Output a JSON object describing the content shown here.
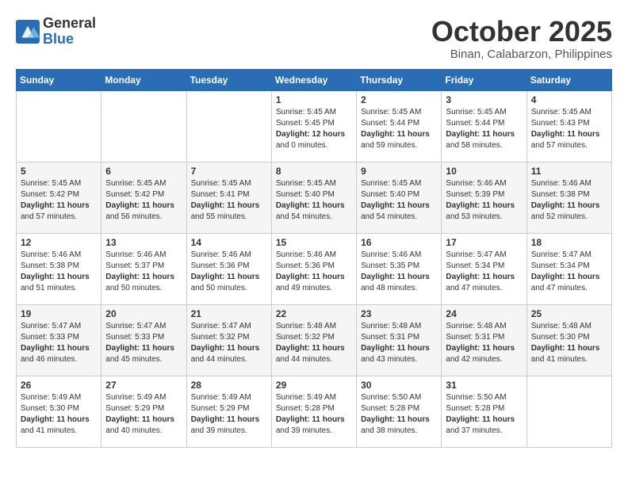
{
  "header": {
    "logo_general": "General",
    "logo_blue": "Blue",
    "month_title": "October 2025",
    "location": "Binan, Calabarzon, Philippines"
  },
  "days_of_week": [
    "Sunday",
    "Monday",
    "Tuesday",
    "Wednesday",
    "Thursday",
    "Friday",
    "Saturday"
  ],
  "weeks": [
    [
      {
        "day": "",
        "content": ""
      },
      {
        "day": "",
        "content": ""
      },
      {
        "day": "",
        "content": ""
      },
      {
        "day": "1",
        "content": "Sunrise: 5:45 AM\nSunset: 5:45 PM\nDaylight: 12 hours\nand 0 minutes."
      },
      {
        "day": "2",
        "content": "Sunrise: 5:45 AM\nSunset: 5:44 PM\nDaylight: 11 hours\nand 59 minutes."
      },
      {
        "day": "3",
        "content": "Sunrise: 5:45 AM\nSunset: 5:44 PM\nDaylight: 11 hours\nand 58 minutes."
      },
      {
        "day": "4",
        "content": "Sunrise: 5:45 AM\nSunset: 5:43 PM\nDaylight: 11 hours\nand 57 minutes."
      }
    ],
    [
      {
        "day": "5",
        "content": "Sunrise: 5:45 AM\nSunset: 5:42 PM\nDaylight: 11 hours\nand 57 minutes."
      },
      {
        "day": "6",
        "content": "Sunrise: 5:45 AM\nSunset: 5:42 PM\nDaylight: 11 hours\nand 56 minutes."
      },
      {
        "day": "7",
        "content": "Sunrise: 5:45 AM\nSunset: 5:41 PM\nDaylight: 11 hours\nand 55 minutes."
      },
      {
        "day": "8",
        "content": "Sunrise: 5:45 AM\nSunset: 5:40 PM\nDaylight: 11 hours\nand 54 minutes."
      },
      {
        "day": "9",
        "content": "Sunrise: 5:45 AM\nSunset: 5:40 PM\nDaylight: 11 hours\nand 54 minutes."
      },
      {
        "day": "10",
        "content": "Sunrise: 5:46 AM\nSunset: 5:39 PM\nDaylight: 11 hours\nand 53 minutes."
      },
      {
        "day": "11",
        "content": "Sunrise: 5:46 AM\nSunset: 5:38 PM\nDaylight: 11 hours\nand 52 minutes."
      }
    ],
    [
      {
        "day": "12",
        "content": "Sunrise: 5:46 AM\nSunset: 5:38 PM\nDaylight: 11 hours\nand 51 minutes."
      },
      {
        "day": "13",
        "content": "Sunrise: 5:46 AM\nSunset: 5:37 PM\nDaylight: 11 hours\nand 50 minutes."
      },
      {
        "day": "14",
        "content": "Sunrise: 5:46 AM\nSunset: 5:36 PM\nDaylight: 11 hours\nand 50 minutes."
      },
      {
        "day": "15",
        "content": "Sunrise: 5:46 AM\nSunset: 5:36 PM\nDaylight: 11 hours\nand 49 minutes."
      },
      {
        "day": "16",
        "content": "Sunrise: 5:46 AM\nSunset: 5:35 PM\nDaylight: 11 hours\nand 48 minutes."
      },
      {
        "day": "17",
        "content": "Sunrise: 5:47 AM\nSunset: 5:34 PM\nDaylight: 11 hours\nand 47 minutes."
      },
      {
        "day": "18",
        "content": "Sunrise: 5:47 AM\nSunset: 5:34 PM\nDaylight: 11 hours\nand 47 minutes."
      }
    ],
    [
      {
        "day": "19",
        "content": "Sunrise: 5:47 AM\nSunset: 5:33 PM\nDaylight: 11 hours\nand 46 minutes."
      },
      {
        "day": "20",
        "content": "Sunrise: 5:47 AM\nSunset: 5:33 PM\nDaylight: 11 hours\nand 45 minutes."
      },
      {
        "day": "21",
        "content": "Sunrise: 5:47 AM\nSunset: 5:32 PM\nDaylight: 11 hours\nand 44 minutes."
      },
      {
        "day": "22",
        "content": "Sunrise: 5:48 AM\nSunset: 5:32 PM\nDaylight: 11 hours\nand 44 minutes."
      },
      {
        "day": "23",
        "content": "Sunrise: 5:48 AM\nSunset: 5:31 PM\nDaylight: 11 hours\nand 43 minutes."
      },
      {
        "day": "24",
        "content": "Sunrise: 5:48 AM\nSunset: 5:31 PM\nDaylight: 11 hours\nand 42 minutes."
      },
      {
        "day": "25",
        "content": "Sunrise: 5:48 AM\nSunset: 5:30 PM\nDaylight: 11 hours\nand 41 minutes."
      }
    ],
    [
      {
        "day": "26",
        "content": "Sunrise: 5:49 AM\nSunset: 5:30 PM\nDaylight: 11 hours\nand 41 minutes."
      },
      {
        "day": "27",
        "content": "Sunrise: 5:49 AM\nSunset: 5:29 PM\nDaylight: 11 hours\nand 40 minutes."
      },
      {
        "day": "28",
        "content": "Sunrise: 5:49 AM\nSunset: 5:29 PM\nDaylight: 11 hours\nand 39 minutes."
      },
      {
        "day": "29",
        "content": "Sunrise: 5:49 AM\nSunset: 5:28 PM\nDaylight: 11 hours\nand 39 minutes."
      },
      {
        "day": "30",
        "content": "Sunrise: 5:50 AM\nSunset: 5:28 PM\nDaylight: 11 hours\nand 38 minutes."
      },
      {
        "day": "31",
        "content": "Sunrise: 5:50 AM\nSunset: 5:28 PM\nDaylight: 11 hours\nand 37 minutes."
      },
      {
        "day": "",
        "content": ""
      }
    ]
  ]
}
